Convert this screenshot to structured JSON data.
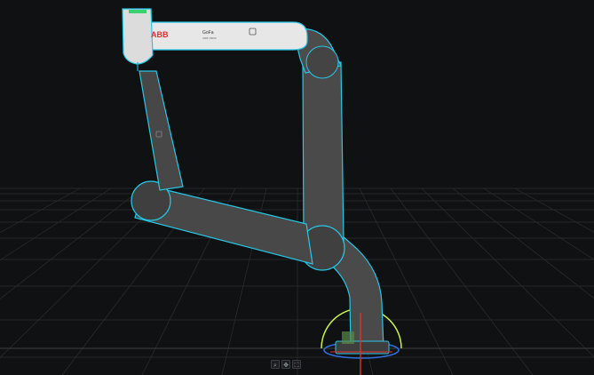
{
  "viewport": {
    "background": "#101112",
    "grid_color": "#2b2e31",
    "outline_color": "#27c7e6",
    "robot_body_color": "#4a4a4a",
    "upper_arm_color": "#e7e7e7"
  },
  "robot": {
    "brand_logo": "ABB",
    "model_label": "GoFa",
    "model_sublabel": "CRB 15000",
    "status_led_color": "#3bd16f"
  },
  "gizmo": {
    "arc_color": "#c8f04a",
    "x_axis_color": "#e03131",
    "y_axis_color": "#2f6fe0",
    "z_axis_color": "#1fb3c9"
  },
  "toolbar": {
    "buttons": [
      {
        "icon": "zoom-icon",
        "glyph": "⌕"
      },
      {
        "icon": "move-icon",
        "glyph": "✥"
      },
      {
        "icon": "fit-view-icon",
        "glyph": "⛶"
      }
    ]
  }
}
